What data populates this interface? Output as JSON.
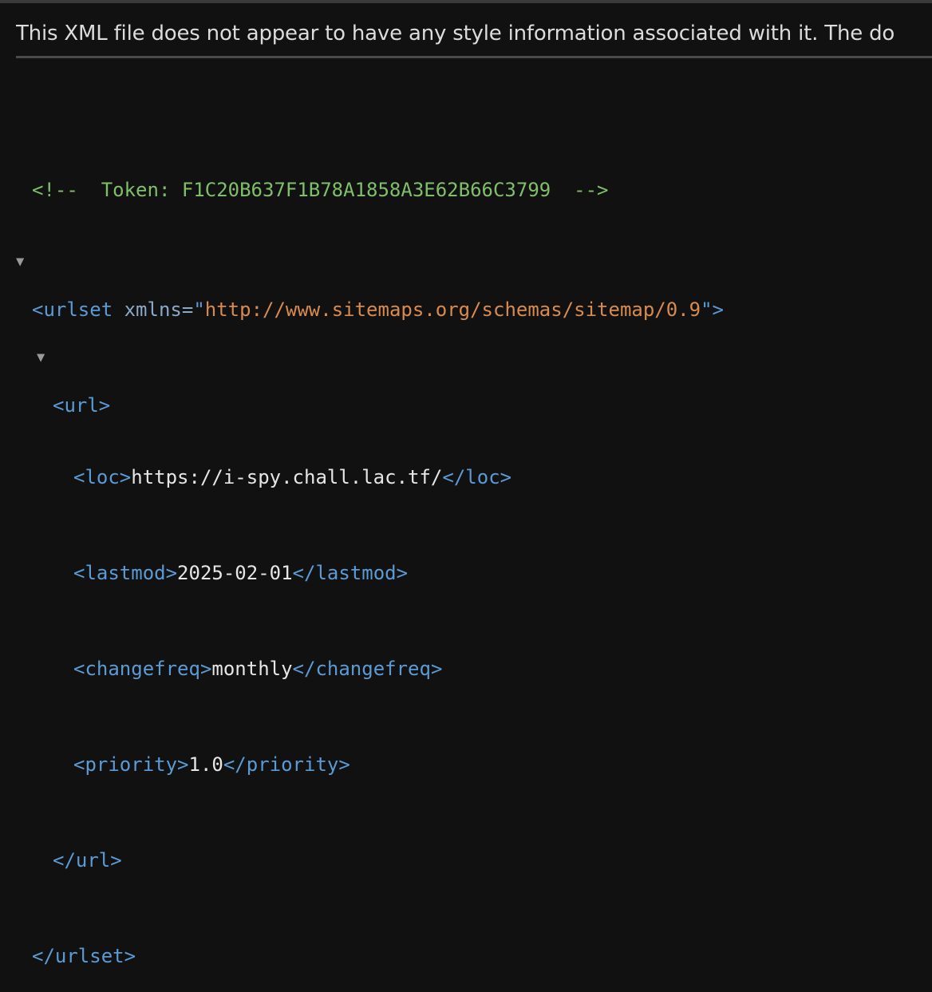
{
  "notice": "This XML file does not appear to have any style information associated with it. The do",
  "comment": "<!--  Token: F1C20B637F1B78A1858A3E62B66C3799  -->",
  "urlset": {
    "open_tag_start": "<urlset",
    "attr_name": " xmlns=",
    "attr_quote_open": "\"",
    "attr_value": "http://www.sitemaps.org/schemas/sitemap/0.9",
    "attr_quote_close": "\"",
    "open_tag_end": ">",
    "close_tag": "</urlset>"
  },
  "url": {
    "open_tag": "<url>",
    "close_tag": "</url>"
  },
  "loc": {
    "open": "<loc>",
    "value": "https://i-spy.chall.lac.tf/",
    "close": "</loc>"
  },
  "lastmod": {
    "open": "<lastmod>",
    "value": "2025-02-01",
    "close": "</lastmod>"
  },
  "changefreq": {
    "open": "<changefreq>",
    "value": "monthly",
    "close": "</changefreq>"
  },
  "priority": {
    "open": "<priority>",
    "value": "1.0",
    "close": "</priority>"
  },
  "toggle_glyph": "▼"
}
